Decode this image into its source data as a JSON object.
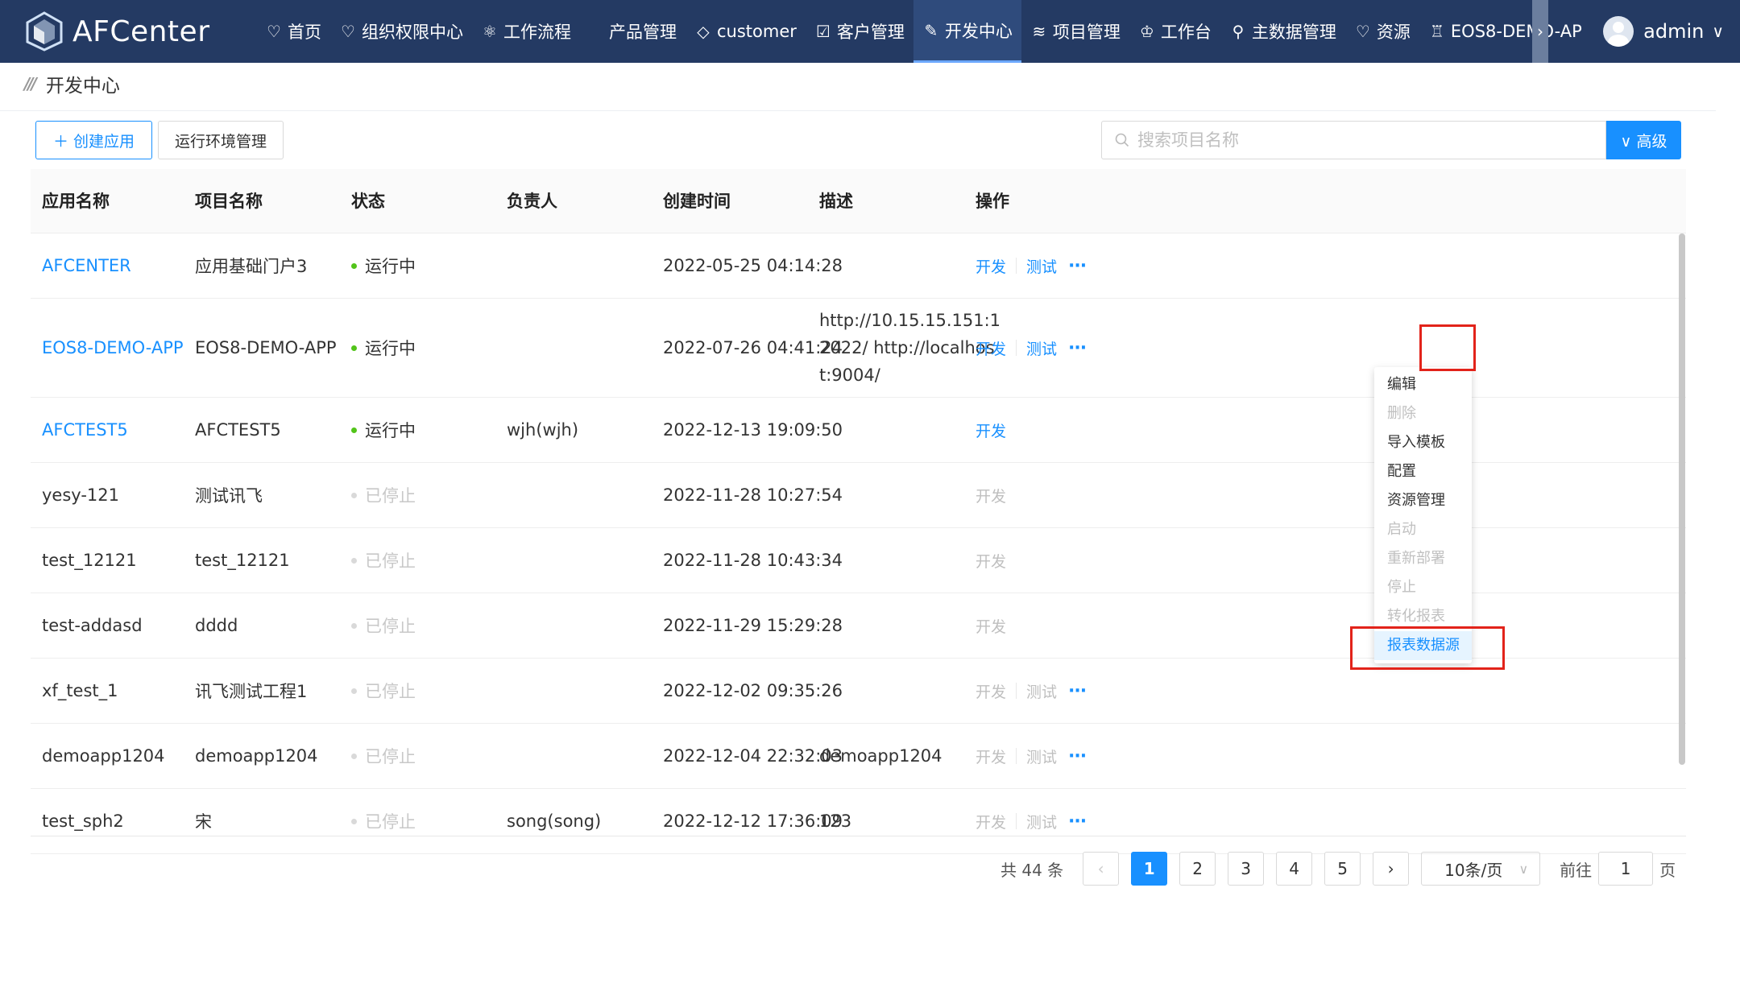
{
  "header": {
    "logo_text": "AFCenter",
    "nav": [
      {
        "icon": "♡",
        "label": "首页"
      },
      {
        "icon": "♡",
        "label": "组织权限中心"
      },
      {
        "icon": "⚛",
        "label": "工作流程"
      },
      {
        "icon": "",
        "label": "产品管理"
      },
      {
        "icon": "◇",
        "label": "customer"
      },
      {
        "icon": "☑",
        "label": "客户管理"
      },
      {
        "icon": "✎",
        "label": "开发中心"
      },
      {
        "icon": "≋",
        "label": "项目管理"
      },
      {
        "icon": "♔",
        "label": "工作台"
      },
      {
        "icon": "⚲",
        "label": "主数据管理"
      },
      {
        "icon": "♡",
        "label": "资源"
      },
      {
        "icon": "♖",
        "label": "EOS8-DEMO-AP"
      }
    ],
    "nav_more_icon": "›",
    "user_name": "admin",
    "user_chevron": "∨"
  },
  "breadcrumb": {
    "icon": "///",
    "title": "开发中心"
  },
  "toolbar": {
    "create_label": "＋ 创建应用",
    "env_label": "运行环境管理",
    "search_placeholder": "搜索项目名称",
    "advanced_label": "∨ 高级"
  },
  "table": {
    "columns": [
      "应用名称",
      "项目名称",
      "状态",
      "负责人",
      "创建时间",
      "描述",
      "操作"
    ],
    "rows": [
      {
        "app": "AFCENTER",
        "project": "应用基础门户3",
        "status": "运行中",
        "running": true,
        "owner": "",
        "created": "2022-05-25 04:14:28",
        "desc": "",
        "ops": [
          "开发",
          "测试"
        ]
      },
      {
        "app": "EOS8-DEMO-APP",
        "project": "EOS8-DEMO-APP",
        "status": "运行中",
        "running": true,
        "owner": "",
        "created": "2022-07-26 04:41:24",
        "desc": "http://10.15.15.151:12022/ http://localhost:9004/",
        "ops": [
          "开发",
          "测试"
        ]
      },
      {
        "app": "AFCTEST5",
        "project": "AFCTEST5",
        "status": "运行中",
        "running": true,
        "owner": "wjh(wjh)",
        "created": "2022-12-13 19:09:50",
        "desc": "",
        "ops": [
          "开发"
        ]
      },
      {
        "app": "yesy-121",
        "project": "测试讯飞",
        "status": "已停止",
        "running": false,
        "owner": "",
        "created": "2022-11-28 10:27:54",
        "desc": "",
        "ops": [
          "开发"
        ]
      },
      {
        "app": "test_12121",
        "project": "test_12121",
        "status": "已停止",
        "running": false,
        "owner": "",
        "created": "2022-11-28 10:43:34",
        "desc": "",
        "ops": [
          "开发"
        ]
      },
      {
        "app": "test-addasd",
        "project": "dddd",
        "status": "已停止",
        "running": false,
        "owner": "",
        "created": "2022-11-29 15:29:28",
        "desc": "",
        "ops": [
          "开发"
        ]
      },
      {
        "app": "xf_test_1",
        "project": "讯飞测试工程1",
        "status": "已停止",
        "running": false,
        "owner": "",
        "created": "2022-12-02 09:35:26",
        "desc": "",
        "ops": [
          "开发",
          "测试"
        ]
      },
      {
        "app": "demoapp1204",
        "project": "demoapp1204",
        "status": "已停止",
        "running": false,
        "owner": "",
        "created": "2022-12-04 22:32:03",
        "desc": "demoapp1204",
        "ops": [
          "开发",
          "测试"
        ]
      },
      {
        "app": "test_sph2",
        "project": "宋",
        "status": "已停止",
        "running": false,
        "owner": "song(song)",
        "created": "2022-12-12 17:36:09",
        "desc": "123",
        "ops": [
          "开发",
          "测试"
        ]
      }
    ],
    "more_label": "···"
  },
  "dropdown": {
    "items": [
      {
        "label": "编辑",
        "state": "enabled"
      },
      {
        "label": "删除",
        "state": "disabled"
      },
      {
        "label": "导入模板",
        "state": "enabled"
      },
      {
        "label": "配置",
        "state": "enabled"
      },
      {
        "label": "资源管理",
        "state": "enabled"
      },
      {
        "label": "启动",
        "state": "disabled"
      },
      {
        "label": "重新部署",
        "state": "disabled"
      },
      {
        "label": "停止",
        "state": "disabled"
      },
      {
        "label": "转化报表",
        "state": "disabled"
      },
      {
        "label": "报表数据源",
        "state": "hover"
      }
    ]
  },
  "pagination": {
    "total_text": "共 44 条",
    "prev": "‹",
    "next": "›",
    "pages": [
      "1",
      "2",
      "3",
      "4",
      "5"
    ],
    "current": "1",
    "page_size": "10条/页",
    "size_chevron": "∨",
    "goto_label": "前往",
    "goto_value": "1",
    "page_suffix": "页"
  },
  "colors": {
    "header_bg": "#243a63",
    "accent": "#1890ff",
    "highlight": "#e2231a",
    "running": "#52c41a"
  }
}
